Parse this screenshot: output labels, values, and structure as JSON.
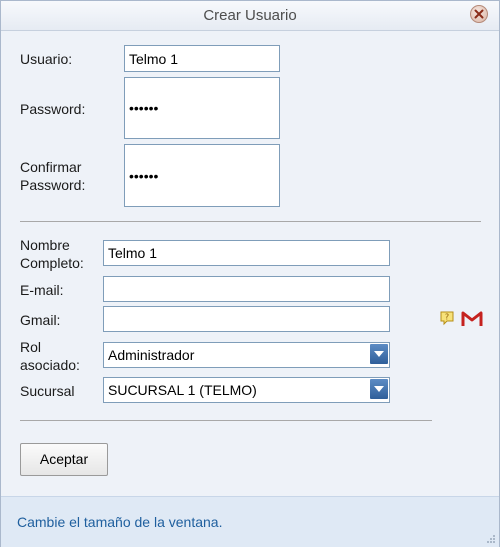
{
  "window": {
    "title": "Crear Usuario"
  },
  "form": {
    "usuario_label": "Usuario:",
    "usuario_value": "Telmo 1",
    "password_label": "Password:",
    "password_value": "••••••",
    "confirm_label_line1": "Confirmar",
    "confirm_label_line2": "Password:",
    "confirm_value": "••••••",
    "nombre_label_line1": "Nombre",
    "nombre_label_line2": "Completo:",
    "nombre_value": "Telmo 1",
    "email_label": "E-mail:",
    "email_value": "",
    "gmail_label": "Gmail:",
    "gmail_value": "",
    "rol_label_line1": "Rol",
    "rol_label_line2": "asociado:",
    "rol_value": "Administrador",
    "sucursal_label": "Sucursal",
    "sucursal_value": "SUCURSAL 1 (TELMO)"
  },
  "buttons": {
    "accept_label": "Aceptar"
  },
  "status": {
    "message": "Cambie el tamaño de la ventana."
  },
  "icons": {
    "close": "close-icon",
    "help": "help-note-icon",
    "gmail": "gmail-icon"
  },
  "colors": {
    "accent": "#2f5f9a",
    "status_text": "#1f5f9e",
    "gmail_red": "#c5221f"
  }
}
